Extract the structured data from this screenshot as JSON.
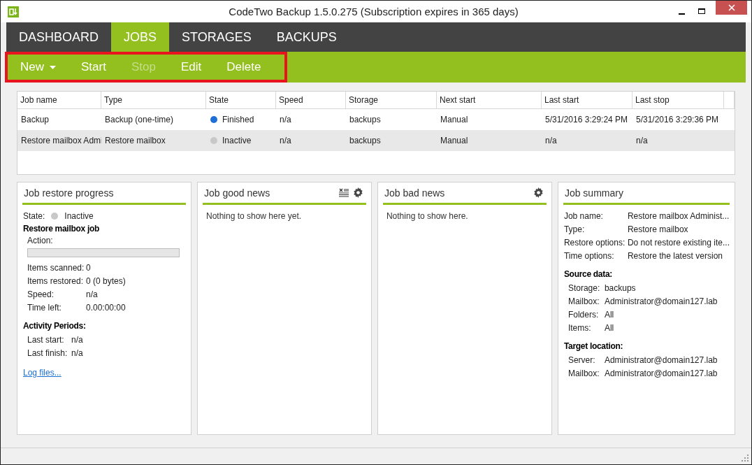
{
  "window": {
    "title": "CodeTwo Backup 1.5.0.275 (Subscription expires in 365 days)"
  },
  "nav_tabs": [
    {
      "label": "DASHBOARD",
      "selected": false
    },
    {
      "label": "JOBS",
      "selected": true
    },
    {
      "label": "STORAGES",
      "selected": false
    },
    {
      "label": "BACKUPS",
      "selected": false
    }
  ],
  "toolbar": {
    "highlighted": true,
    "buttons": [
      {
        "label": "New",
        "kind": "dropdown",
        "disabled": false
      },
      {
        "label": "Start",
        "kind": "plain",
        "disabled": false
      },
      {
        "label": "Stop",
        "kind": "plain",
        "disabled": true
      },
      {
        "label": "Edit",
        "kind": "plain",
        "disabled": false
      },
      {
        "label": "Delete",
        "kind": "plain",
        "disabled": false
      }
    ]
  },
  "table": {
    "columns": [
      "Job name",
      "Type",
      "State",
      "Speed",
      "Storage",
      "Next start",
      "Last start",
      "Last stop"
    ],
    "rows": [
      {
        "selected": false,
        "job_name": "Backup",
        "type": "Backup (one-time)",
        "state": {
          "label": "Finished",
          "color": "#1e6fd9"
        },
        "speed": "n/a",
        "storage": "backups",
        "next_start": "Manual",
        "last_start": "5/31/2016 3:29:24 PM",
        "last_stop": "5/31/2016 3:29:36 PM"
      },
      {
        "selected": true,
        "job_name": "Restore mailbox Admi",
        "type": "Restore mailbox",
        "state": {
          "label": "Inactive",
          "color": "#c8c8c8"
        },
        "speed": "n/a",
        "storage": "backups",
        "next_start": "Manual",
        "last_start": "n/a",
        "last_stop": "n/a"
      }
    ]
  },
  "progress_panel": {
    "title": "Job restore progress",
    "state_label": "State:",
    "state": {
      "label": "Inactive",
      "color": "#c8c8c8"
    },
    "heading": "Restore mailbox job",
    "action_label": "Action:",
    "level": 0,
    "fields": [
      {
        "label": "Items scanned:",
        "value": "0"
      },
      {
        "label": "Items restored:",
        "value": "0 (0 bytes)"
      },
      {
        "label": "Speed:",
        "value": "n/a"
      },
      {
        "label": "Time left:",
        "value": "0.00:00:00"
      }
    ],
    "activity_heading": "Activity Periods:",
    "activity": [
      {
        "label": "Last start:",
        "value": "n/a"
      },
      {
        "label": "Last finish:",
        "value": "n/a"
      }
    ],
    "link": "Log files..."
  },
  "good_news_panel": {
    "title": "Job good news",
    "message": "Nothing to show here yet."
  },
  "bad_news_panel": {
    "title": "Job bad news",
    "message": "Nothing to show here."
  },
  "summary_panel": {
    "title": "Job summary",
    "fields": [
      {
        "label": "Job name:",
        "value": "Restore mailbox Administ..."
      },
      {
        "label": "Type:",
        "value": "Restore mailbox"
      },
      {
        "label": "Restore options:",
        "value": "Do not restore existing ite..."
      },
      {
        "label": "Time options:",
        "value": "Restore the latest version"
      }
    ],
    "source_heading": "Source data:",
    "source": [
      {
        "label": "Storage:",
        "value": "backups"
      },
      {
        "label": "Mailbox:",
        "value": "Administrator@domain127.lab"
      },
      {
        "label": "Folders:",
        "value": "All"
      },
      {
        "label": "Items:",
        "value": "All"
      }
    ],
    "target_heading": "Target location:",
    "target": [
      {
        "label": "Server:",
        "value": "Administrator@domain127.lab"
      },
      {
        "label": "Mailbox:",
        "value": "Administrator@domain127.lab"
      }
    ]
  }
}
